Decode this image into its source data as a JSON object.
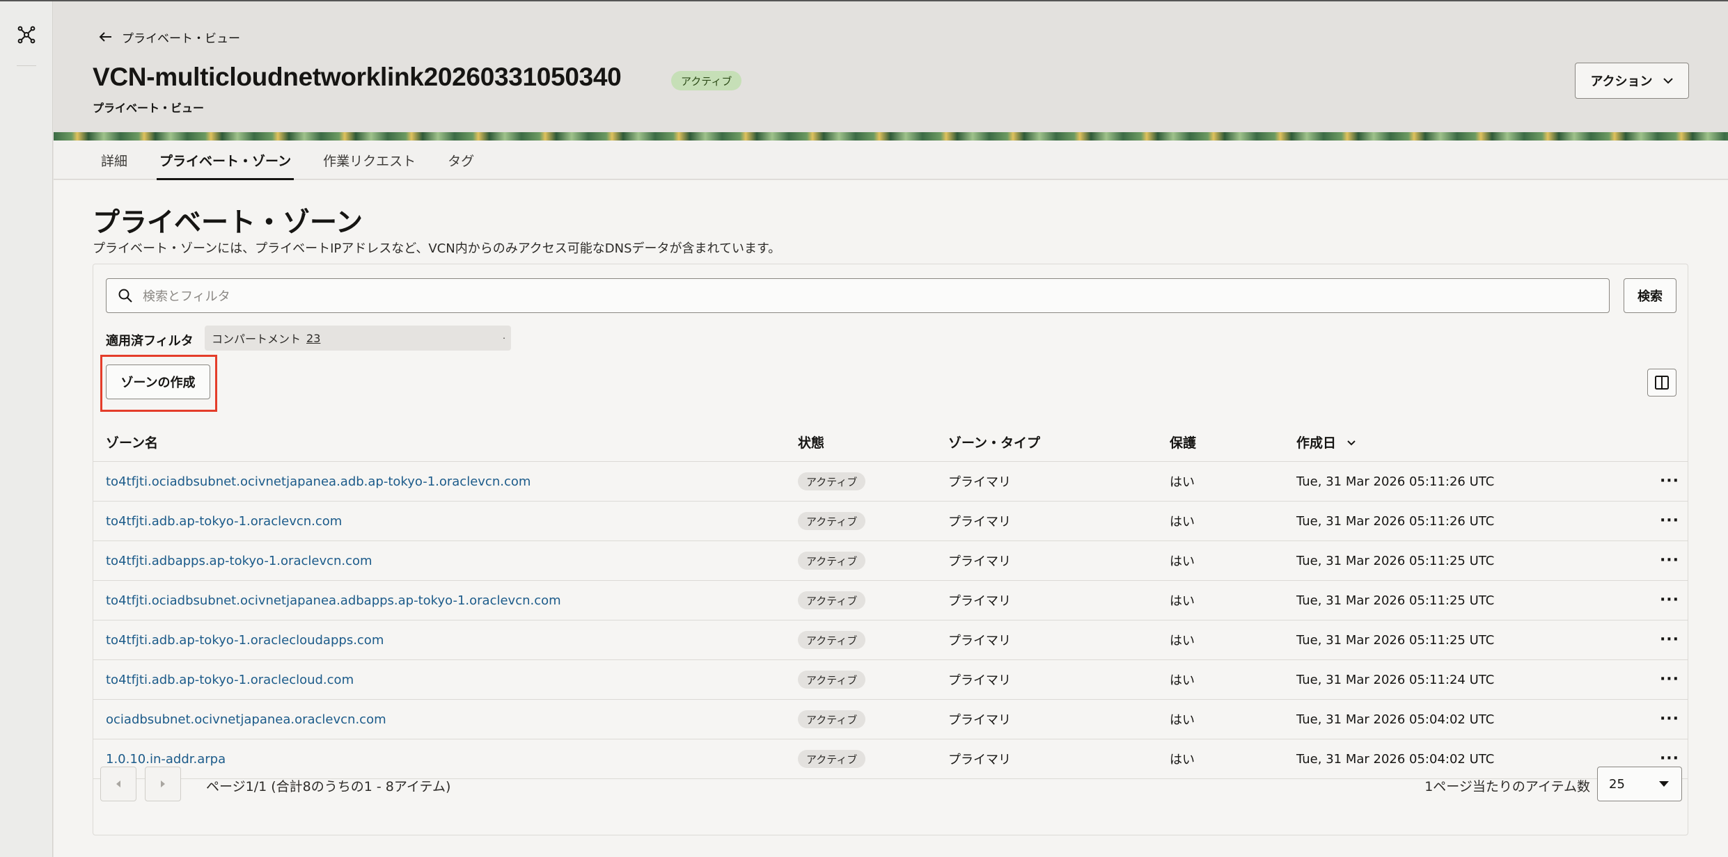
{
  "header": {
    "back_label": "プライベート・ビュー",
    "title": "VCN-multicloudnetworklink20260331050340",
    "status": "アクティブ",
    "subtitle": "プライベート・ビュー",
    "action_label": "アクション"
  },
  "tabs": [
    {
      "label": "詳細",
      "active": false
    },
    {
      "label": "プライベート・ゾーン",
      "active": true
    },
    {
      "label": "作業リクエスト",
      "active": false
    },
    {
      "label": "タグ",
      "active": false
    }
  ],
  "section": {
    "title": "プライベート・ゾーン",
    "description": "プライベート・ゾーンには、プライベートIPアドレスなど、VCN内からのみアクセス可能なDNSデータが含まれています。"
  },
  "search": {
    "placeholder": "検索とフィルタ",
    "button_label": "検索"
  },
  "filters": {
    "label": "適用済フィルタ",
    "chip_label": "コンパートメント",
    "chip_value": "23"
  },
  "create_button": "ゾーンの作成",
  "table": {
    "headers": {
      "name": "ゾーン名",
      "state": "状態",
      "type": "ゾーン・タイプ",
      "protected": "保護",
      "created": "作成日"
    },
    "rows": [
      {
        "name": "to4tfjti.ociadbsubnet.ocivnetjapanea.adb.ap-tokyo-1.oraclevcn.com",
        "state": "アクティブ",
        "type": "プライマリ",
        "protected": "はい",
        "created": "Tue, 31 Mar 2026 05:11:26 UTC"
      },
      {
        "name": "to4tfjti.adb.ap-tokyo-1.oraclevcn.com",
        "state": "アクティブ",
        "type": "プライマリ",
        "protected": "はい",
        "created": "Tue, 31 Mar 2026 05:11:26 UTC"
      },
      {
        "name": "to4tfjti.adbapps.ap-tokyo-1.oraclevcn.com",
        "state": "アクティブ",
        "type": "プライマリ",
        "protected": "はい",
        "created": "Tue, 31 Mar 2026 05:11:25 UTC"
      },
      {
        "name": "to4tfjti.ociadbsubnet.ocivnetjapanea.adbapps.ap-tokyo-1.oraclevcn.com",
        "state": "アクティブ",
        "type": "プライマリ",
        "protected": "はい",
        "created": "Tue, 31 Mar 2026 05:11:25 UTC"
      },
      {
        "name": "to4tfjti.adb.ap-tokyo-1.oraclecloudapps.com",
        "state": "アクティブ",
        "type": "プライマリ",
        "protected": "はい",
        "created": "Tue, 31 Mar 2026 05:11:25 UTC"
      },
      {
        "name": "to4tfjti.adb.ap-tokyo-1.oraclecloud.com",
        "state": "アクティブ",
        "type": "プライマリ",
        "protected": "はい",
        "created": "Tue, 31 Mar 2026 05:11:24 UTC"
      },
      {
        "name": "ociadbsubnet.ocivnetjapanea.oraclevcn.com",
        "state": "アクティブ",
        "type": "プライマリ",
        "protected": "はい",
        "created": "Tue, 31 Mar 2026 05:04:02 UTC"
      },
      {
        "name": "1.0.10.in-addr.arpa",
        "state": "アクティブ",
        "type": "プライマリ",
        "protected": "はい",
        "created": "Tue, 31 Mar 2026 05:04:02 UTC"
      }
    ]
  },
  "pagination": {
    "summary": "ページ1/1 (合計8のうちの1 - 8アイテム)",
    "items_per_page_label": "1ページ当たりのアイテム数",
    "items_per_page_value": "25"
  },
  "colors": {
    "link": "#1c5b8a",
    "highlight": "#e43d2a",
    "status_active_bg": "#c6dfb7"
  }
}
